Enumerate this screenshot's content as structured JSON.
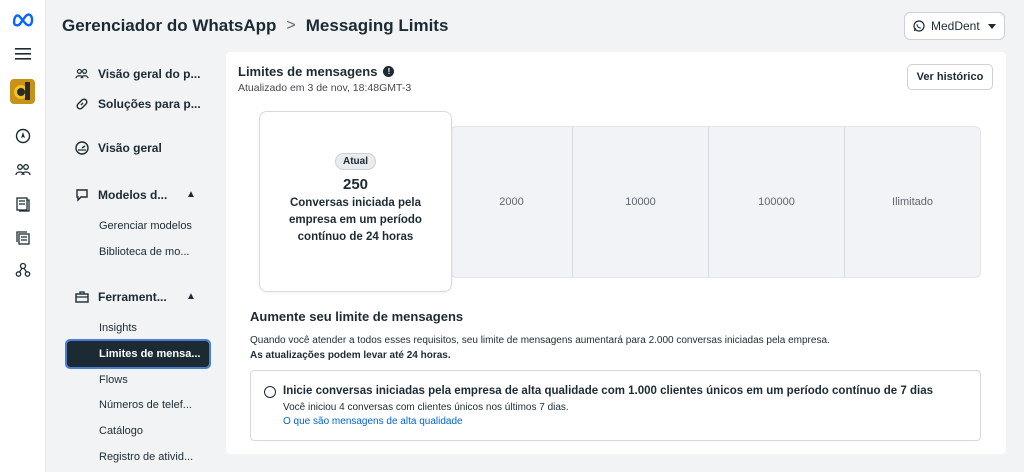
{
  "rail": {
    "icons": [
      "meta-logo-icon",
      "menu-icon",
      "business-avatar",
      "compass-icon",
      "people-icon",
      "catalog-icon",
      "pages-icon",
      "network-icon"
    ]
  },
  "header": {
    "app": "Gerenciador do WhatsApp",
    "separator": ">",
    "page": "Messaging Limits",
    "account": "MedDent"
  },
  "sidebar": {
    "items": [
      {
        "label": "Visão geral do p...",
        "icon": "people-icon"
      },
      {
        "label": "Soluções para p...",
        "icon": "link-icon"
      },
      {
        "label": "Visão geral",
        "icon": "gauge-icon"
      },
      {
        "label": "Modelos d...",
        "icon": "chat-icon",
        "expanded": true
      },
      {
        "label": "Ferrament...",
        "icon": "toolbox-icon",
        "expanded": true
      }
    ],
    "templates_sub": [
      "Gerenciar modelos",
      "Biblioteca de mo..."
    ],
    "tools_sub": [
      "Insights",
      "Limites de mensa...",
      "Flows",
      "Números de telef...",
      "Catálogo",
      "Registro de ativid..."
    ],
    "active": "Limites de mensa..."
  },
  "card": {
    "title": "Limites de mensagens",
    "updated": "Atualizado em 3 de nov, 18:48GMT-3",
    "history_button": "Ver histórico",
    "current": {
      "badge": "Atual",
      "value": "250",
      "description": "Conversas iniciada pela empresa em um período contínuo de 24 horas"
    },
    "tiers": [
      "2000",
      "10000",
      "100000",
      "Ilimitado"
    ],
    "increase": {
      "title": "Aumente seu limite de mensagens",
      "description": "Quando você atender a todos esses requisitos, seu limite de mensagens aumentará para 2.000 conversas iniciadas pela empresa.",
      "note": "As atualizações podem levar até 24 horas."
    },
    "requirement": {
      "title": "Inicie conversas iniciadas pela empresa de alta qualidade com 1.000 clientes únicos em um período contínuo de 7 dias",
      "status": "Você iniciou 4 conversas com clientes únicos nos últimos 7 dias.",
      "link": "O que são mensagens de alta qualidade"
    }
  }
}
